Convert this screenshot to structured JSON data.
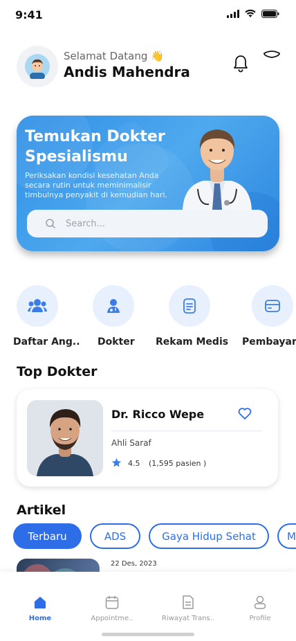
{
  "status_bar": {
    "time": "9:41"
  },
  "header": {
    "greeting": "Selamat Datang 👋",
    "user_name": "Andis Mahendra"
  },
  "banner": {
    "title": "Temukan Dokter Spesialismu",
    "description": "Periksakan kondisi kesehatan Anda secara rutin untuk meminimalisir timbulnya penyakit di kemudian hari.",
    "search_placeholder": "Search..."
  },
  "categories": [
    {
      "label": "Daftar Ang..",
      "icon": "users-icon"
    },
    {
      "label": "Dokter",
      "icon": "doctor-icon"
    },
    {
      "label": "Rekam Medis",
      "icon": "document-icon"
    },
    {
      "label": "Pembayaran",
      "icon": "card-icon"
    }
  ],
  "top_doctor": {
    "section_title": "Top Dokter",
    "name": "Dr. Ricco Wepe",
    "specialty": "Ahli Saraf",
    "rating": "4.5",
    "patients": "(1,595 pasien )"
  },
  "articles": {
    "section_title": "Artikel",
    "chips": [
      "Terbaru",
      "ADS",
      "Gaya Hidup Sehat",
      "M"
    ],
    "first_article_date": "22 Des, 2023"
  },
  "bottom_nav": [
    {
      "label": "Home",
      "active": true
    },
    {
      "label": "Appointme..",
      "active": false
    },
    {
      "label": "Riwayat Trans..",
      "active": false
    },
    {
      "label": "Profile",
      "active": false
    }
  ],
  "colors": {
    "primary": "#2d6ee8",
    "banner": "#3b9ae9",
    "icon_bg": "#e7f0fc"
  }
}
